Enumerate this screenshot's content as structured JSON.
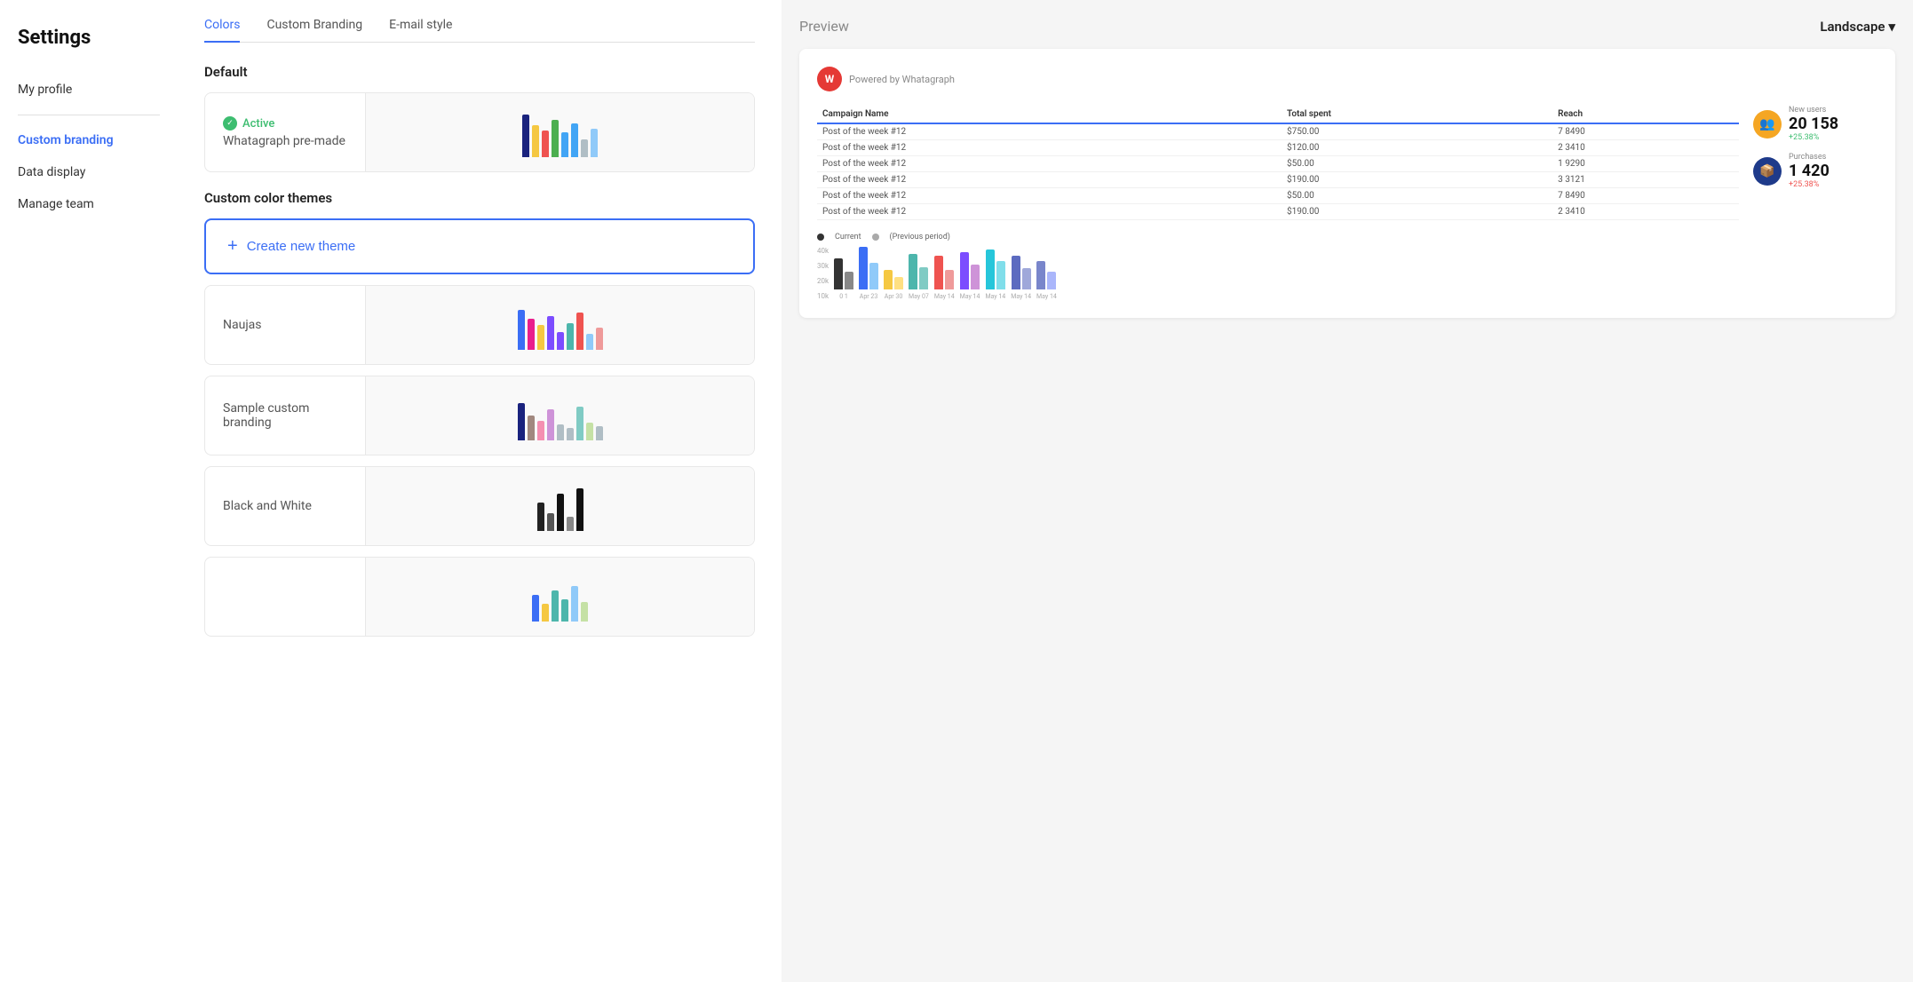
{
  "sidebar": {
    "title": "Settings",
    "nav_items": [
      {
        "label": "My profile",
        "active": false
      },
      {
        "label": "Custom branding",
        "active": true
      },
      {
        "label": "Data display",
        "active": false
      },
      {
        "label": "Manage team",
        "active": false
      }
    ]
  },
  "tabs": [
    {
      "label": "Colors",
      "active": true
    },
    {
      "label": "Custom Branding",
      "active": false
    },
    {
      "label": "E-mail style",
      "active": false
    }
  ],
  "default_section": {
    "title": "Default",
    "theme": {
      "active_label": "Active",
      "name": "Whatagraph pre-made"
    }
  },
  "custom_section": {
    "title": "Custom color themes",
    "create_btn_label": "Create new theme"
  },
  "themes": [
    {
      "name": "Naujas",
      "bars": [
        {
          "color": "#3b6ef5",
          "height": 45
        },
        {
          "color": "#e91e8c",
          "height": 35
        },
        {
          "color": "#f5c842",
          "height": 28
        },
        {
          "color": "#7c4dff",
          "height": 38
        },
        {
          "color": "#7c4dff",
          "height": 20
        },
        {
          "color": "#4db6ac",
          "height": 30
        },
        {
          "color": "#ef5350",
          "height": 42
        },
        {
          "color": "#90caf9",
          "height": 18
        },
        {
          "color": "#ef9a9a",
          "height": 25
        }
      ]
    },
    {
      "name": "Sample custom branding",
      "bars": [
        {
          "color": "#1a237e",
          "height": 42
        },
        {
          "color": "#a1887f",
          "height": 28
        },
        {
          "color": "#f48fb1",
          "height": 22
        },
        {
          "color": "#ce93d8",
          "height": 35
        },
        {
          "color": "#b0bec5",
          "height": 18
        },
        {
          "color": "#b0bec5",
          "height": 14
        },
        {
          "color": "#80cbc4",
          "height": 38
        },
        {
          "color": "#c5e1a5",
          "height": 20
        },
        {
          "color": "#b0bec5",
          "height": 16
        }
      ]
    },
    {
      "name": "Black and White",
      "bars": [
        {
          "color": "#222",
          "height": 32
        },
        {
          "color": "#555",
          "height": 20
        },
        {
          "color": "#111",
          "height": 42
        },
        {
          "color": "#888",
          "height": 16
        },
        {
          "color": "#111",
          "height": 48
        }
      ]
    },
    {
      "name": "",
      "bars": [
        {
          "color": "#3b6ef5",
          "height": 30
        },
        {
          "color": "#f5c842",
          "height": 20
        },
        {
          "color": "#4db6ac",
          "height": 35
        },
        {
          "color": "#4db6ac",
          "height": 25
        },
        {
          "color": "#90caf9",
          "height": 40
        },
        {
          "color": "#c5e1a5",
          "height": 22
        }
      ]
    }
  ],
  "preview": {
    "title": "Preview",
    "orientation": "Landscape",
    "report": {
      "logo_letter": "W",
      "logo_text": "Powered by Whatagraph",
      "table": {
        "headers": [
          "Campaign Name",
          "Total spent",
          "Reach"
        ],
        "rows": [
          [
            "Post of the week #12",
            "$750.00",
            "7 8490"
          ],
          [
            "Post of the week #12",
            "$120.00",
            "2 3410"
          ],
          [
            "Post of the week #12",
            "$50.00",
            "1 9290"
          ],
          [
            "Post of the week #12",
            "$190.00",
            "3 3121"
          ],
          [
            "Post of the week #12",
            "$50.00",
            "7 8490"
          ],
          [
            "Post of the week #12",
            "$190.00",
            "2 3410"
          ]
        ]
      },
      "stats": [
        {
          "label": "New users",
          "value": "20 158",
          "change": "+25.38%",
          "icon_color": "#f5a623"
        },
        {
          "label": "Purchases",
          "value": "1 420",
          "change": "+25.38%",
          "icon_color": "#1e3a8a"
        }
      ],
      "chart": {
        "legend": [
          "Current",
          "(Previous period)"
        ],
        "y_labels": [
          "40k",
          "30k",
          "20k",
          "10k"
        ],
        "x_labels": [
          "0 1",
          "Apr 23",
          "Apr 30",
          "May 07",
          "May 14",
          "May 14",
          "May 14",
          "May 14",
          "May 14",
          "May 14"
        ],
        "bars": [
          [
            {
              "color": "#333",
              "h": 35
            },
            {
              "color": "#888",
              "h": 20
            }
          ],
          [
            {
              "color": "#3b6ef5",
              "h": 48
            },
            {
              "color": "#90caf9",
              "h": 30
            }
          ],
          [
            {
              "color": "#f5c842",
              "h": 22
            },
            {
              "color": "#ffe082",
              "h": 14
            }
          ],
          [
            {
              "color": "#4db6ac",
              "h": 40
            },
            {
              "color": "#80cbc4",
              "h": 25
            }
          ],
          [
            {
              "color": "#ef5350",
              "h": 38
            },
            {
              "color": "#ef9a9a",
              "h": 22
            }
          ],
          [
            {
              "color": "#7c4dff",
              "h": 42
            },
            {
              "color": "#ce93d8",
              "h": 28
            }
          ],
          [
            {
              "color": "#26c6da",
              "h": 45
            },
            {
              "color": "#80deea",
              "h": 32
            }
          ],
          [
            {
              "color": "#5c6bc0",
              "h": 38
            },
            {
              "color": "#9fa8da",
              "h": 24
            }
          ],
          [
            {
              "color": "#7986cb",
              "h": 32
            },
            {
              "color": "#aab6fb",
              "h": 20
            }
          ]
        ]
      }
    }
  },
  "default_bars": [
    {
      "color": "#1a237e",
      "height": 48
    },
    {
      "color": "#f5c842",
      "height": 36
    },
    {
      "color": "#ef5350",
      "height": 30
    },
    {
      "color": "#4caf50",
      "height": 42
    },
    {
      "color": "#42a5f5",
      "height": 28
    },
    {
      "color": "#42a5f5",
      "height": 38
    },
    {
      "color": "#b0bec5",
      "height": 20
    },
    {
      "color": "#90caf9",
      "height": 32
    }
  ]
}
